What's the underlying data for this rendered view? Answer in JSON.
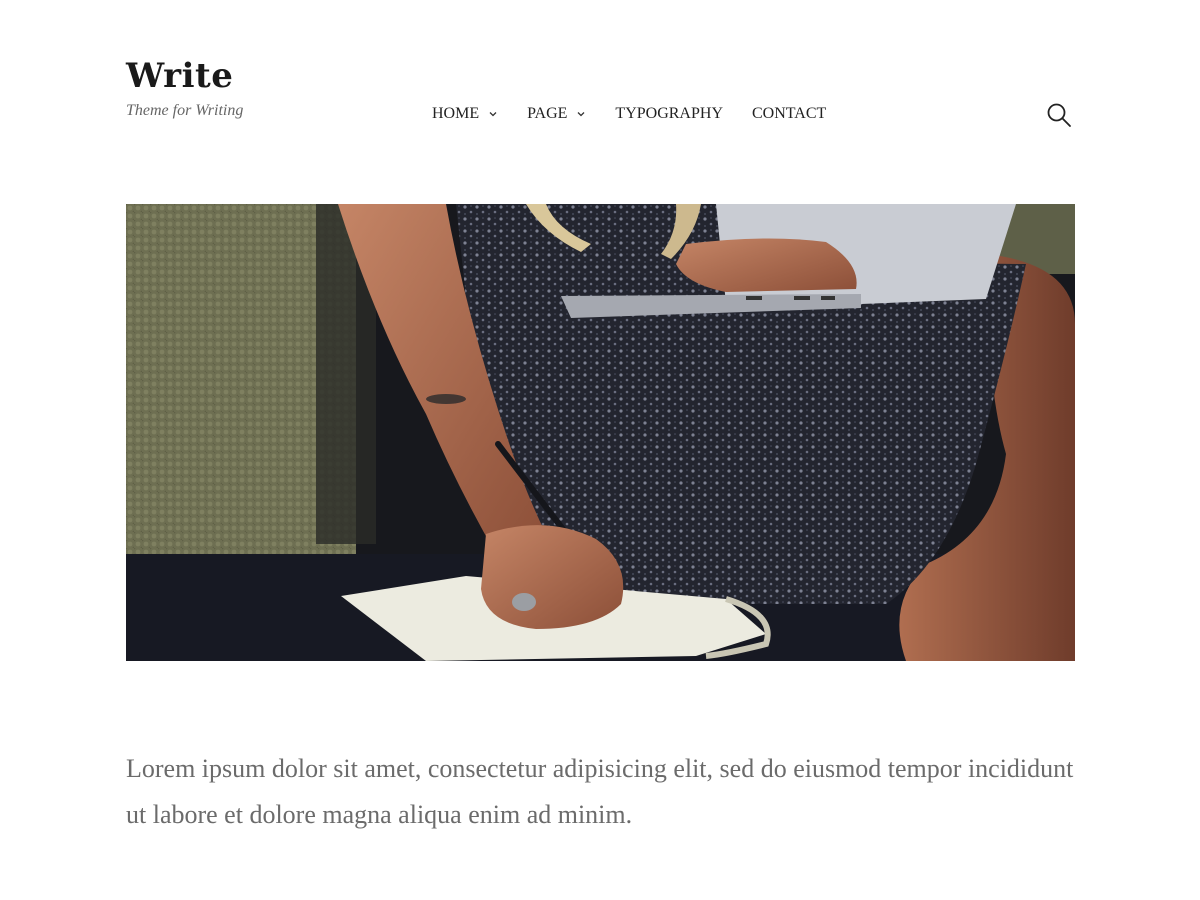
{
  "site": {
    "title": "Write",
    "tagline": "Theme for Writing"
  },
  "nav": {
    "items": [
      {
        "label": "HOME",
        "has_dropdown": true
      },
      {
        "label": "PAGE",
        "has_dropdown": true
      },
      {
        "label": "TYPOGRAPHY",
        "has_dropdown": false
      },
      {
        "label": "CONTACT",
        "has_dropdown": false
      }
    ],
    "search_icon": "search-icon"
  },
  "hero": {
    "alt_icon": "photo"
  },
  "content": {
    "intro": "Lorem ipsum dolor sit amet, consectetur adipisicing elit, sed do eiusmod tempor incididunt ut labore et dolore magna aliqua enim ad minim."
  },
  "colors": {
    "text": "#222222",
    "muted": "#6b6b6b",
    "background": "#ffffff"
  }
}
